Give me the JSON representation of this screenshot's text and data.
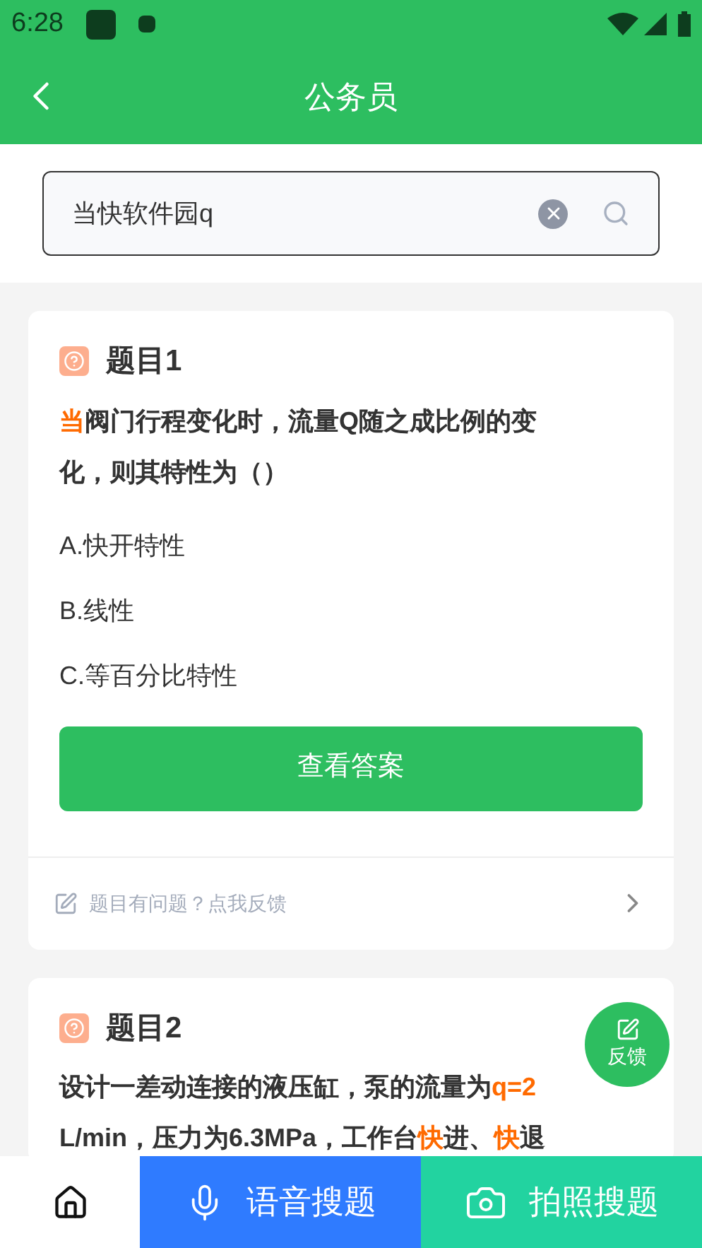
{
  "status_bar": {
    "time": "6:28"
  },
  "header": {
    "title": "公务员"
  },
  "search": {
    "value": "当快软件园q"
  },
  "questions": [
    {
      "title": "题目1",
      "segments": [
        {
          "text": "当",
          "highlight": true
        },
        {
          "text": "阀门行程变化时，流量Q随之成比例的变化，则其特性为（）",
          "highlight": false
        }
      ],
      "options": [
        "A.快开特性",
        "B.线性",
        "C.等百分比特性"
      ],
      "answer_button": "查看答案",
      "feedback": "题目有问题？点我反馈"
    },
    {
      "title": "题目2",
      "segments": [
        {
          "text": "设计一差动连接的液压缸，泵的流量为",
          "highlight": false
        },
        {
          "text": "q=2",
          "highlight": true
        },
        {
          "text": " L/min，压力为6.3MPa，工作台",
          "highlight": false
        },
        {
          "text": "快",
          "highlight": true
        },
        {
          "text": "进、",
          "highlight": false
        },
        {
          "text": "快",
          "highlight": true
        },
        {
          "text": "退",
          "highlight": false
        }
      ]
    }
  ],
  "float_button": {
    "label": "反馈"
  },
  "bottom_bar": {
    "voice": "语音搜题",
    "photo": "拍照搜题"
  }
}
